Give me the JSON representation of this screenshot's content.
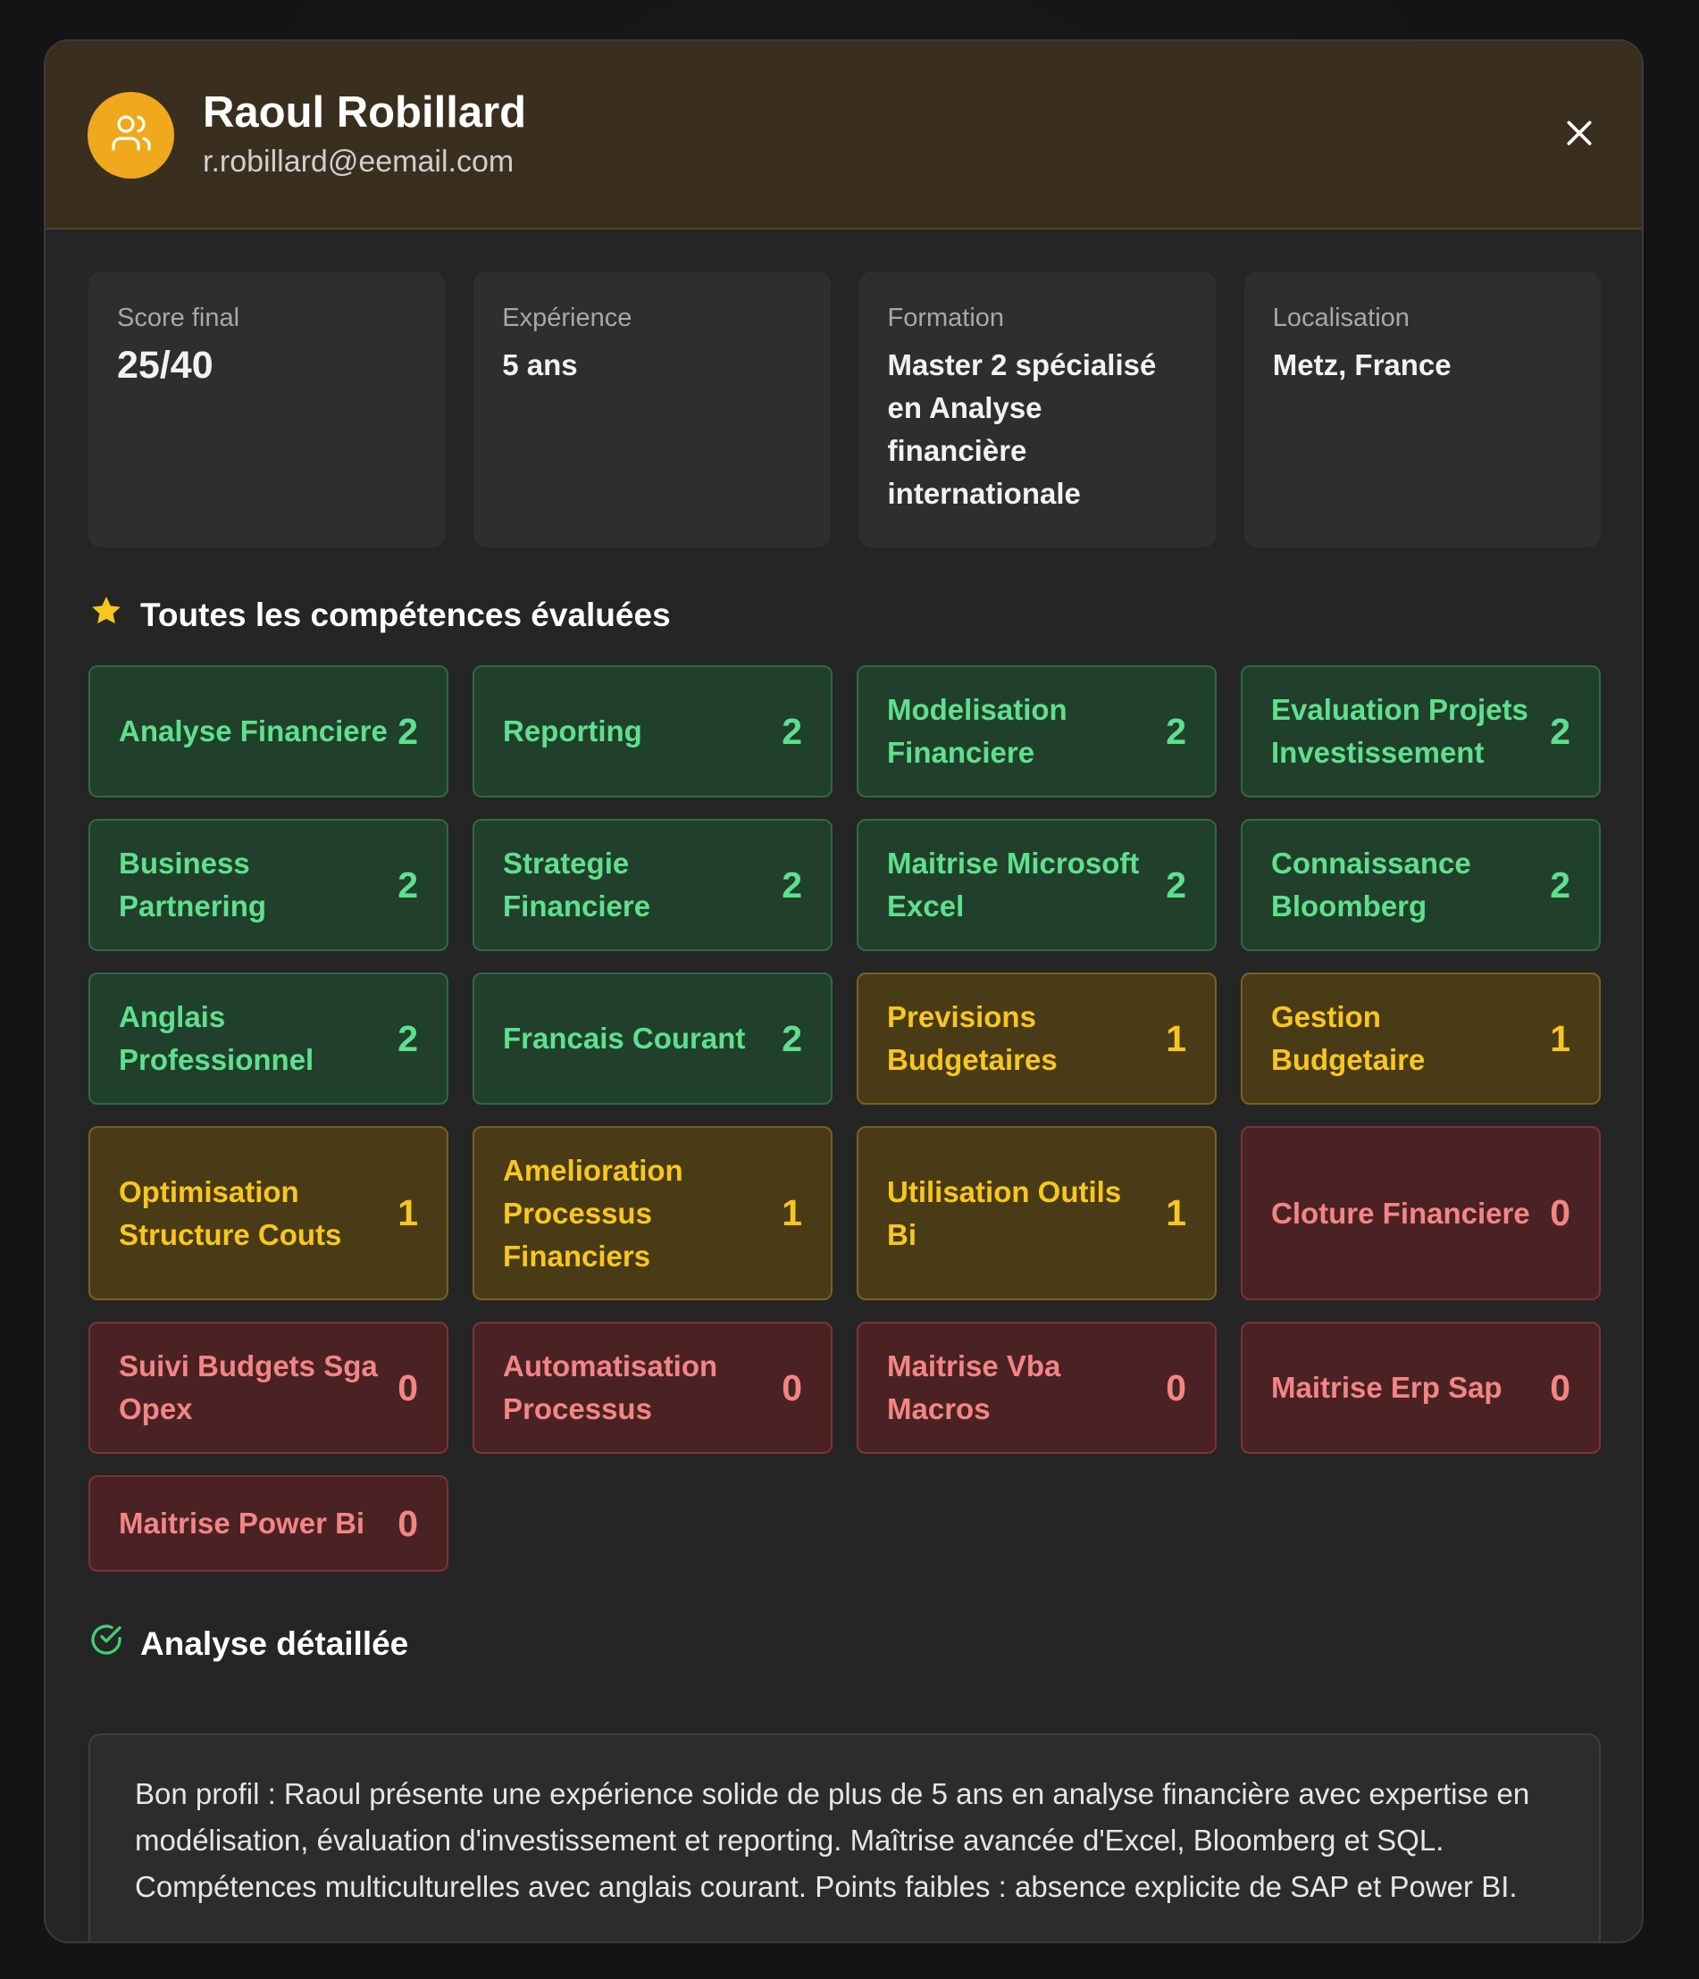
{
  "candidate": {
    "name": "Raoul Robillard",
    "email": "r.robillard@eemail.com",
    "avatar_icon": "users-icon",
    "close_icon": "close-icon"
  },
  "stats": [
    {
      "label": "Score final",
      "value": "25/40"
    },
    {
      "label": "Expérience",
      "value": "5 ans"
    },
    {
      "label": "Formation",
      "value": "Master 2 spécialisé en Analyse financière internationale"
    },
    {
      "label": "Localisation",
      "value": "Metz, France"
    }
  ],
  "skills_section": {
    "title": "Toutes les compétences évaluées",
    "icon": "star-icon"
  },
  "skills": [
    {
      "label": "Analyse Financiere",
      "score": "2"
    },
    {
      "label": "Reporting",
      "score": "2"
    },
    {
      "label": "Modelisation Financiere",
      "score": "2"
    },
    {
      "label": "Evaluation Projets Investissement",
      "score": "2"
    },
    {
      "label": "Business Partnering",
      "score": "2"
    },
    {
      "label": "Strategie Financiere",
      "score": "2"
    },
    {
      "label": "Maitrise Microsoft Excel",
      "score": "2"
    },
    {
      "label": "Connaissance Bloomberg",
      "score": "2"
    },
    {
      "label": "Anglais Professionnel",
      "score": "2"
    },
    {
      "label": "Francais Courant",
      "score": "2"
    },
    {
      "label": "Previsions Budgetaires",
      "score": "1"
    },
    {
      "label": "Gestion Budgetaire",
      "score": "1"
    },
    {
      "label": "Optimisation Structure Couts",
      "score": "1"
    },
    {
      "label": "Amelioration Processus Financiers",
      "score": "1"
    },
    {
      "label": "Utilisation Outils Bi",
      "score": "1"
    },
    {
      "label": "Cloture Financiere",
      "score": "0"
    },
    {
      "label": "Suivi Budgets Sga Opex",
      "score": "0"
    },
    {
      "label": "Automatisation Processus",
      "score": "0"
    },
    {
      "label": "Maitrise Vba Macros",
      "score": "0"
    },
    {
      "label": "Maitrise Erp Sap",
      "score": "0"
    },
    {
      "label": "Maitrise Power Bi",
      "score": "0"
    }
  ],
  "score_colors": {
    "2": "#5fe08c",
    "1": "#f8c71e",
    "0": "#f38584"
  },
  "analysis": {
    "title": "Analyse détaillée",
    "icon": "check-circle-icon",
    "text": "Bon profil : Raoul présente une expérience solide de plus de 5 ans en analyse financière avec expertise en modélisation, évaluation d'investissement et reporting. Maîtrise avancée d'Excel, Bloomberg et SQL. Compétences multiculturelles avec anglais courant. Points faibles : absence explicite de SAP et Power BI."
  }
}
